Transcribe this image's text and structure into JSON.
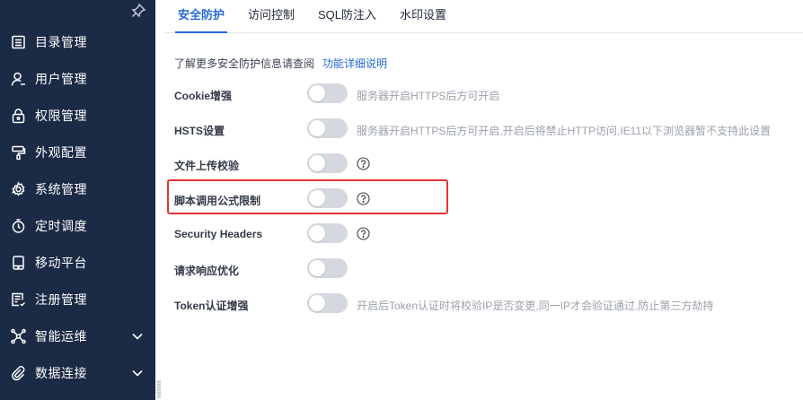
{
  "sidebar": {
    "pin_icon": "pin-icon",
    "items": [
      {
        "label": "目录管理",
        "icon": "catalog-icon"
      },
      {
        "label": "用户管理",
        "icon": "user-icon"
      },
      {
        "label": "权限管理",
        "icon": "lock-icon"
      },
      {
        "label": "外观配置",
        "icon": "brush-icon"
      },
      {
        "label": "系统管理",
        "icon": "gear-icon"
      },
      {
        "label": "定时调度",
        "icon": "timer-icon"
      },
      {
        "label": "移动平台",
        "icon": "tablet-icon"
      },
      {
        "label": "注册管理",
        "icon": "register-icon"
      },
      {
        "label": "智能运维",
        "icon": "network-icon",
        "expandable": true
      },
      {
        "label": "数据连接",
        "icon": "link-icon",
        "expandable": true
      }
    ]
  },
  "tabs": [
    {
      "label": "安全防护",
      "active": true
    },
    {
      "label": "访问控制",
      "active": false
    },
    {
      "label": "SQL防注入",
      "active": false
    },
    {
      "label": "水印设置",
      "active": false
    }
  ],
  "intro": {
    "text": "了解更多安全防护信息请查阅",
    "link": "功能详细说明"
  },
  "settings": [
    {
      "label": "Cookie增强",
      "enabled": false,
      "desc": "服务器开启HTTPS后方可开启"
    },
    {
      "label": "HSTS设置",
      "enabled": false,
      "desc": "服务器开启HTTPS后方可开启,开启后将禁止HTTP访问,IE11以下浏览器暂不支持此设置"
    },
    {
      "label": "文件上传校验",
      "enabled": false,
      "help_icon": "question-circle-icon"
    },
    {
      "label": "脚本调用公式限制",
      "enabled": false,
      "help_icon": "question-circle-icon",
      "highlighted": true
    },
    {
      "label": "Security Headers",
      "enabled": false,
      "help_icon": "question-circle-icon"
    },
    {
      "label": "请求响应优化",
      "enabled": false
    },
    {
      "label": "Token认证增强",
      "enabled": false,
      "desc": "开启后Token认证时将校验IP是否变更,同一IP才会验证通过,防止第三方劫持"
    }
  ],
  "colors": {
    "sidebar_bg": "#1b2a45",
    "accent": "#2569d9",
    "toggle_off": "#d5d8de",
    "highlight": "#e53230"
  }
}
